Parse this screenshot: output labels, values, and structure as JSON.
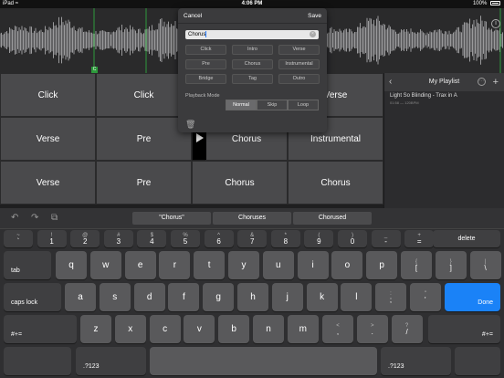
{
  "status_bar": {
    "carrier": "iPad",
    "wifi": "wifi-icon",
    "time": "4:06 PM",
    "battery_percent": "100%"
  },
  "waveform": {
    "marker_label": "C"
  },
  "pads": [
    {
      "label": "Click"
    },
    {
      "label": "Click"
    },
    {
      "label": ""
    },
    {
      "label": "Verse"
    },
    {
      "label": "Verse"
    },
    {
      "label": "Pre"
    },
    {
      "label": "Chorus"
    },
    {
      "label": "Instrumental"
    },
    {
      "label": "Verse"
    },
    {
      "label": "Pre"
    },
    {
      "label": "Chorus"
    },
    {
      "label": "Chorus"
    }
  ],
  "playlist": {
    "title": "My Playlist",
    "song": "Light So Blinding - Trax in A",
    "song_meta": "01:58 — 120BPM"
  },
  "modal": {
    "cancel": "Cancel",
    "save": "Save",
    "name_value": "Chorus",
    "presets": [
      "Click",
      "Intro",
      "Verse",
      "Pre",
      "Chorus",
      "Instrumental",
      "Bridge",
      "Tag",
      "Outro"
    ],
    "playback_mode_label": "Playback Mode",
    "playback_modes": [
      "Normal",
      "Skip",
      "Loop"
    ],
    "playback_mode_selected": "Normal"
  },
  "keyboard": {
    "suggestions": [
      "\"Chorus\"",
      "Choruses",
      "Chorused"
    ],
    "number_row": [
      {
        "top": "~",
        "bottom": "`"
      },
      {
        "top": "!",
        "bottom": "1"
      },
      {
        "top": "@",
        "bottom": "2"
      },
      {
        "top": "#",
        "bottom": "3"
      },
      {
        "top": "$",
        "bottom": "4"
      },
      {
        "top": "%",
        "bottom": "5"
      },
      {
        "top": "^",
        "bottom": "6"
      },
      {
        "top": "&",
        "bottom": "7"
      },
      {
        "top": "*",
        "bottom": "8"
      },
      {
        "top": "(",
        "bottom": "9"
      },
      {
        "top": ")",
        "bottom": "0"
      },
      {
        "top": "_",
        "bottom": "-"
      },
      {
        "top": "+",
        "bottom": "="
      }
    ],
    "delete": "delete",
    "tab": "tab",
    "row_q": [
      "q",
      "w",
      "e",
      "r",
      "t",
      "y",
      "u",
      "i",
      "o",
      "p"
    ],
    "row_q_extra": [
      {
        "top": "{",
        "bottom": "["
      },
      {
        "top": "}",
        "bottom": "]"
      },
      {
        "top": "|",
        "bottom": "\\"
      }
    ],
    "caps": "caps lock",
    "row_a": [
      "a",
      "s",
      "d",
      "f",
      "g",
      "h",
      "j",
      "k",
      "l"
    ],
    "row_a_extra": [
      {
        "top": ":",
        "bottom": ";"
      },
      {
        "top": "\"",
        "bottom": "'"
      }
    ],
    "done": "Done",
    "shift_left": "#+=",
    "row_z": [
      "z",
      "x",
      "c",
      "v",
      "b",
      "n",
      "m"
    ],
    "row_z_extra": [
      {
        "top": "<",
        "bottom": ","
      },
      {
        "top": ">",
        "bottom": "."
      },
      {
        "top": "?",
        "bottom": "/"
      }
    ],
    "shift_right": "#+=",
    "bottom_left": ".?123",
    "bottom_right": ".?123"
  },
  "colors": {
    "accent": "#1a82f7",
    "marker_green": "#2e9a3c"
  }
}
